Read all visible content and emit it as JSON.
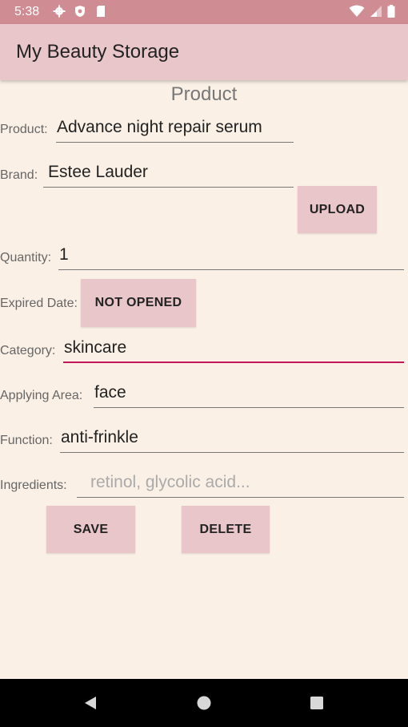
{
  "status": {
    "time": "5:38",
    "icons_left": [
      "gear-icon",
      "shield-icon",
      "sdcard-icon"
    ],
    "icons_right": [
      "wifi-icon",
      "signal-icon",
      "battery-icon"
    ]
  },
  "app": {
    "title": "My Beauty Storage"
  },
  "form": {
    "section_title": "Product",
    "product": {
      "label": "Product:",
      "value": "Advance night repair serum"
    },
    "brand": {
      "label": "Brand:",
      "value": "Estee Lauder"
    },
    "upload_label": "UPLOAD",
    "quantity": {
      "label": "Quantity:",
      "value": "1"
    },
    "expired_date": {
      "label": "Expired Date:",
      "button": "NOT OPENED"
    },
    "category": {
      "label": "Category:",
      "value": "skincare"
    },
    "applying_area": {
      "label": "Applying Area:",
      "value": "face"
    },
    "function": {
      "label": "Function:",
      "value": "anti-frinkle"
    },
    "ingredients": {
      "label": "Ingredients:",
      "placeholder": "retinol, glycolic acid..."
    },
    "save_label": "SAVE",
    "delete_label": "DELETE"
  },
  "nav": {
    "icons": [
      "back-icon",
      "home-icon",
      "recents-icon"
    ]
  },
  "colors": {
    "status_bar": "#d08c93",
    "app_bar": "#e9c6ca",
    "background": "#faf0e6",
    "button": "#e9c6ca",
    "accent": "#c2185b"
  }
}
